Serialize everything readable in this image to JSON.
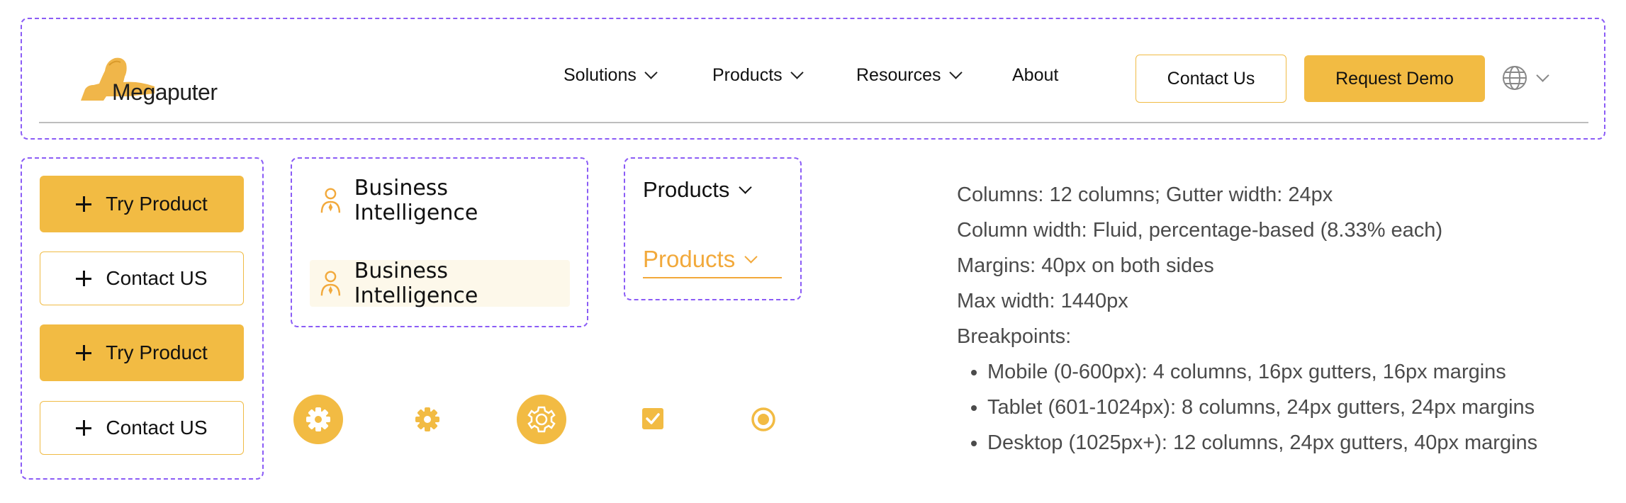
{
  "header": {
    "logo_text": "Megaputer",
    "nav": [
      {
        "label": "Solutions",
        "has_dropdown": true
      },
      {
        "label": "Products",
        "has_dropdown": true
      },
      {
        "label": "Resources",
        "has_dropdown": true
      },
      {
        "label": "About",
        "has_dropdown": false
      }
    ],
    "contact_label": "Contact Us",
    "demo_label": "Request Demo",
    "language_icon": "globe-icon"
  },
  "buttons": [
    {
      "label": "Try Product",
      "style": "filled",
      "icon": "plus-icon"
    },
    {
      "label": "Contact US",
      "style": "outline",
      "icon": "plus-icon"
    },
    {
      "label": "Try Product",
      "style": "filled",
      "icon": "plus-icon"
    },
    {
      "label": "Contact US",
      "style": "outline",
      "icon": "plus-icon"
    }
  ],
  "menu_items": [
    {
      "label": "Business Intelligence",
      "state": "default",
      "icon": "person-icon"
    },
    {
      "label": "Business Intelligence",
      "state": "hover",
      "icon": "person-icon"
    }
  ],
  "dropdowns": [
    {
      "label": "Products",
      "state": "default"
    },
    {
      "label": "Products",
      "state": "hover"
    }
  ],
  "icons": [
    "gear-icon",
    "gear-icon",
    "gear-outline-icon",
    "checkbox-checked-icon",
    "radio-selected-icon"
  ],
  "specs": {
    "lines": [
      "Columns: 12 columns; Gutter width: 24px",
      "Column width: Fluid, percentage-based (8.33% each)",
      "Margins: 40px on both sides",
      "Max width: 1440px",
      "Breakpoints:"
    ],
    "breakpoints": [
      "Mobile (0-600px): 4 columns, 16px gutters, 16px margins",
      "Tablet (601-1024px): 8 columns, 24px gutters, 24px margins",
      "Desktop (1025px+): 12 columns, 24px gutters, 40px margins"
    ]
  },
  "colors": {
    "accent": "#f2bb43",
    "accent_text": "#f2a93b",
    "frame": "#8b5cf6",
    "hover_bg": "#fdf8ea",
    "spec_text": "#4b4b4b"
  }
}
